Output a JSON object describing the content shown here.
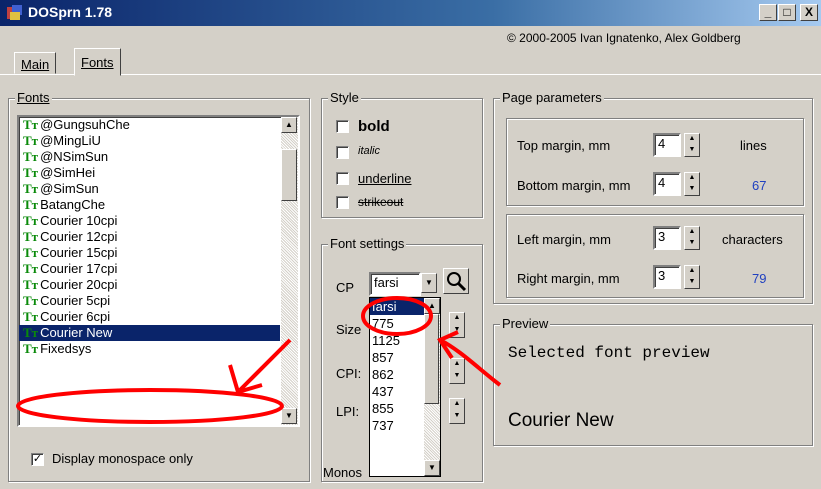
{
  "window": {
    "title": "DOSprn 1.78",
    "min_label": "_",
    "max_label": "□",
    "close_label": "X"
  },
  "tabs": [
    {
      "label": "Main",
      "active": false
    },
    {
      "label": "Fonts",
      "active": true
    }
  ],
  "copyright": "© 2000-2005 Ivan Ignatenko, Alex Goldberg",
  "fonts_group": {
    "label": "Fonts",
    "items": [
      "@GungsuhChe",
      "@MingLiU",
      "@NSimSun",
      "@SimHei",
      "@SimSun",
      "BatangChe",
      "Courier 10cpi",
      "Courier 12cpi",
      "Courier 15cpi",
      "Courier 17cpi",
      "Courier 20cpi",
      "Courier 5cpi",
      "Courier 6cpi",
      "Courier New",
      "Fixedsys"
    ],
    "selected": "Courier New",
    "tt_glyph": "Tт",
    "monospace_only_label": "Display monospace only",
    "monospace_only_checked": true
  },
  "style_group": {
    "label": "Style",
    "bold": "bold",
    "italic": "italic",
    "underline": "underline",
    "strikeout": "strikeout"
  },
  "font_settings": {
    "label": "Font settings",
    "cp_label": "CP",
    "cp_value": "farsi",
    "size_label": "Size",
    "cpi_label": "CPI:",
    "lpi_label": "LPI:",
    "cp_options": [
      "farsi",
      "775",
      "1125",
      "857",
      "862",
      "437",
      "855",
      "737"
    ],
    "monospace_label": "Monos"
  },
  "page_params": {
    "label": "Page parameters",
    "top_margin_label": "Top margin, mm",
    "top_margin_value": "4",
    "bottom_margin_label": "Bottom margin, mm",
    "bottom_margin_value": "4",
    "lines_label": "lines",
    "lines_value": "67",
    "left_margin_label": "Left margin, mm",
    "left_margin_value": "3",
    "right_margin_label": "Right margin, mm",
    "right_margin_value": "3",
    "chars_label": "characters",
    "chars_value": "79"
  },
  "preview": {
    "label": "Preview",
    "sample_text": "Selected font preview",
    "font_name": "Courier New"
  },
  "colors": {
    "annotation_red": "#ff0000",
    "selection_blue": "#0a246a",
    "value_blue": "#2040c0"
  }
}
